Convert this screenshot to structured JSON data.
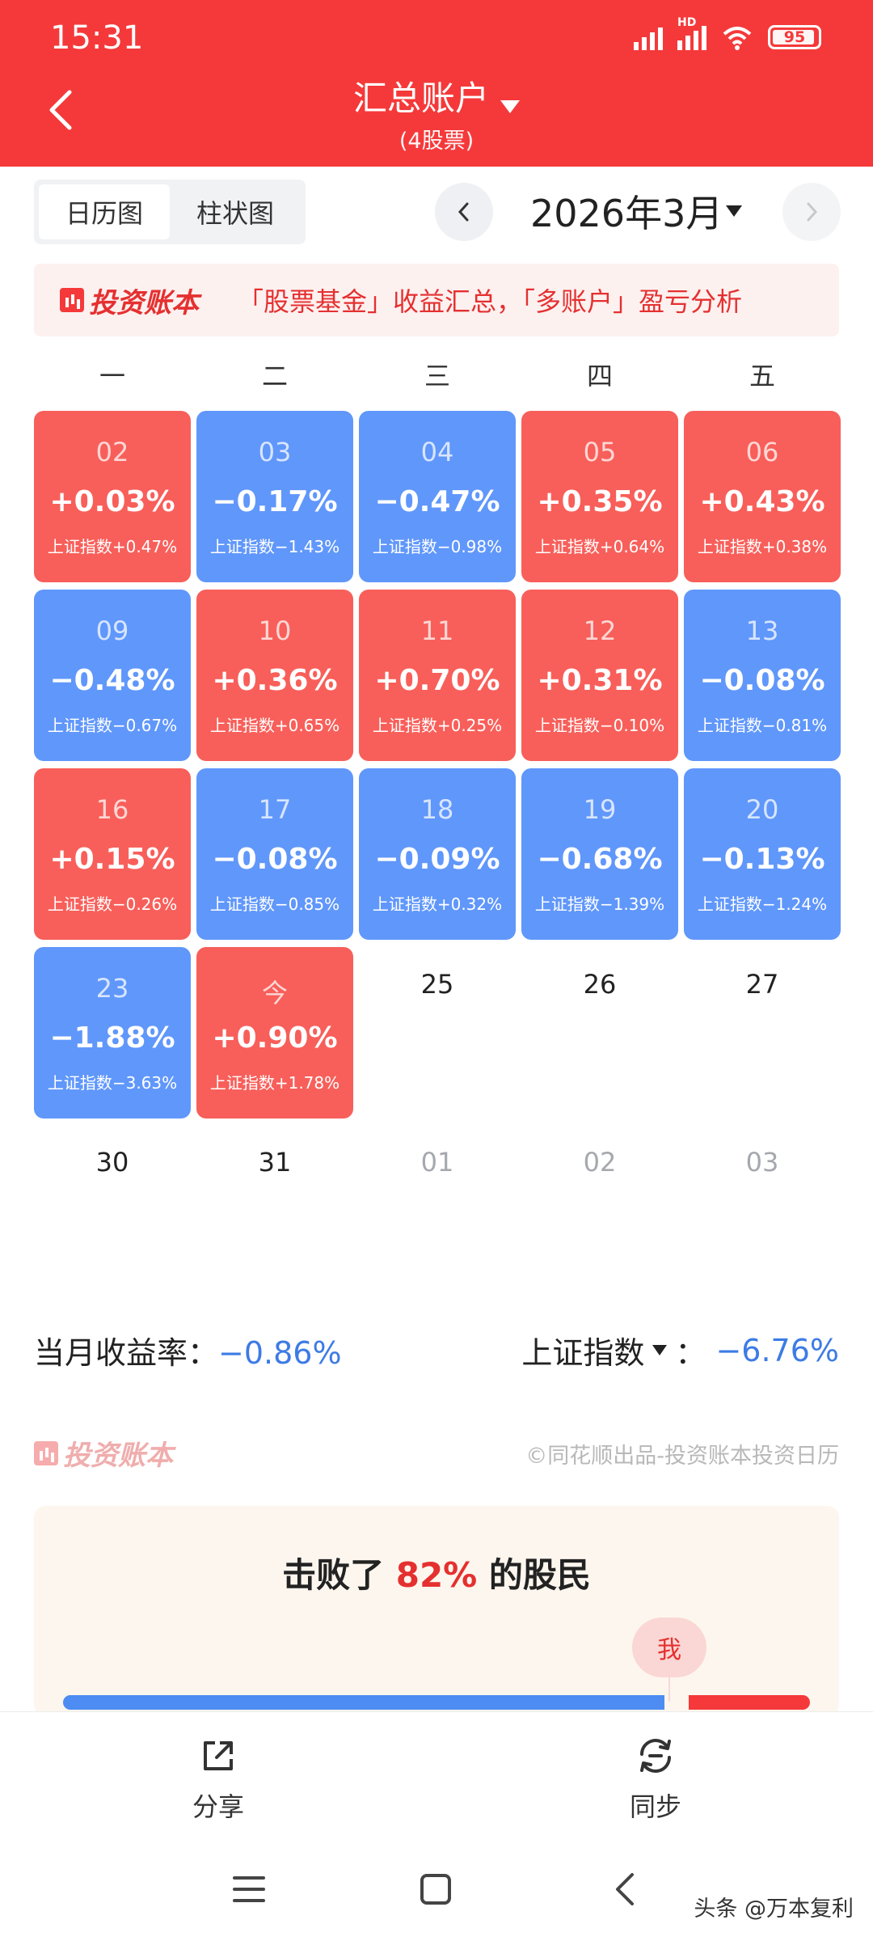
{
  "status_bar": {
    "time": "15:31",
    "network": "HD",
    "battery": "95"
  },
  "header": {
    "title": "汇总账户",
    "subtitle": "(4股票)"
  },
  "view_toggle": {
    "options": [
      "日历图",
      "柱状图"
    ],
    "active": "日历图"
  },
  "month_selector": {
    "label": "2026年3月"
  },
  "banner": {
    "logo": "投资账本",
    "text": "「股票基金」收益汇总，「多账户」盈亏分析"
  },
  "weekdays": [
    "一",
    "二",
    "三",
    "四",
    "五"
  ],
  "calendar": [
    {
      "date": "02",
      "pct": "+0.03%",
      "index": "上证指数+0.47%",
      "color": "red"
    },
    {
      "date": "03",
      "pct": "−0.17%",
      "index": "上证指数−1.43%",
      "color": "blue"
    },
    {
      "date": "04",
      "pct": "−0.47%",
      "index": "上证指数−0.98%",
      "color": "blue"
    },
    {
      "date": "05",
      "pct": "+0.35%",
      "index": "上证指数+0.64%",
      "color": "red"
    },
    {
      "date": "06",
      "pct": "+0.43%",
      "index": "上证指数+0.38%",
      "color": "red"
    },
    {
      "date": "09",
      "pct": "−0.48%",
      "index": "上证指数−0.67%",
      "color": "blue"
    },
    {
      "date": "10",
      "pct": "+0.36%",
      "index": "上证指数+0.65%",
      "color": "red"
    },
    {
      "date": "11",
      "pct": "+0.70%",
      "index": "上证指数+0.25%",
      "color": "red"
    },
    {
      "date": "12",
      "pct": "+0.31%",
      "index": "上证指数−0.10%",
      "color": "red"
    },
    {
      "date": "13",
      "pct": "−0.08%",
      "index": "上证指数−0.81%",
      "color": "blue"
    },
    {
      "date": "16",
      "pct": "+0.15%",
      "index": "上证指数−0.26%",
      "color": "red"
    },
    {
      "date": "17",
      "pct": "−0.08%",
      "index": "上证指数−0.85%",
      "color": "blue"
    },
    {
      "date": "18",
      "pct": "−0.09%",
      "index": "上证指数+0.32%",
      "color": "blue"
    },
    {
      "date": "19",
      "pct": "−0.68%",
      "index": "上证指数−1.39%",
      "color": "blue"
    },
    {
      "date": "20",
      "pct": "−0.13%",
      "index": "上证指数−1.24%",
      "color": "blue"
    },
    {
      "date": "23",
      "pct": "−1.88%",
      "index": "上证指数−3.63%",
      "color": "blue"
    },
    {
      "date": "今",
      "pct": "+0.90%",
      "index": "上证指数+1.78%",
      "color": "red"
    }
  ],
  "plain_days": [
    {
      "date": "25",
      "kind": "cur"
    },
    {
      "date": "26",
      "kind": "cur"
    },
    {
      "date": "27",
      "kind": "cur"
    },
    {
      "date": "30",
      "kind": "cur"
    },
    {
      "date": "31",
      "kind": "cur"
    },
    {
      "date": "01",
      "kind": "next"
    },
    {
      "date": "02",
      "kind": "next"
    },
    {
      "date": "03",
      "kind": "next"
    }
  ],
  "summary": {
    "month_return_label": "当月收益率：",
    "month_return_value": "−0.86%",
    "index_label": "上证指数",
    "index_separator": "：",
    "index_value": "−6.76%"
  },
  "footer_brand": {
    "logo": "投资账本",
    "copyright": "©同花顺出品-投资账本投资日历"
  },
  "beat": {
    "prefix": "击败了 ",
    "pct": "82%",
    "suffix": " 的股民",
    "me_label": "我",
    "percentile": 0.82
  },
  "actions": [
    {
      "label": "分享",
      "icon": "share-icon"
    },
    {
      "label": "同步",
      "icon": "sync-icon"
    }
  ],
  "watermark": "头条 @万本复利",
  "colors": {
    "header_red": "#f5393a",
    "gain_red": "#f85f5a",
    "loss_blue": "#6097fb",
    "value_blue": "#3d7be5"
  }
}
